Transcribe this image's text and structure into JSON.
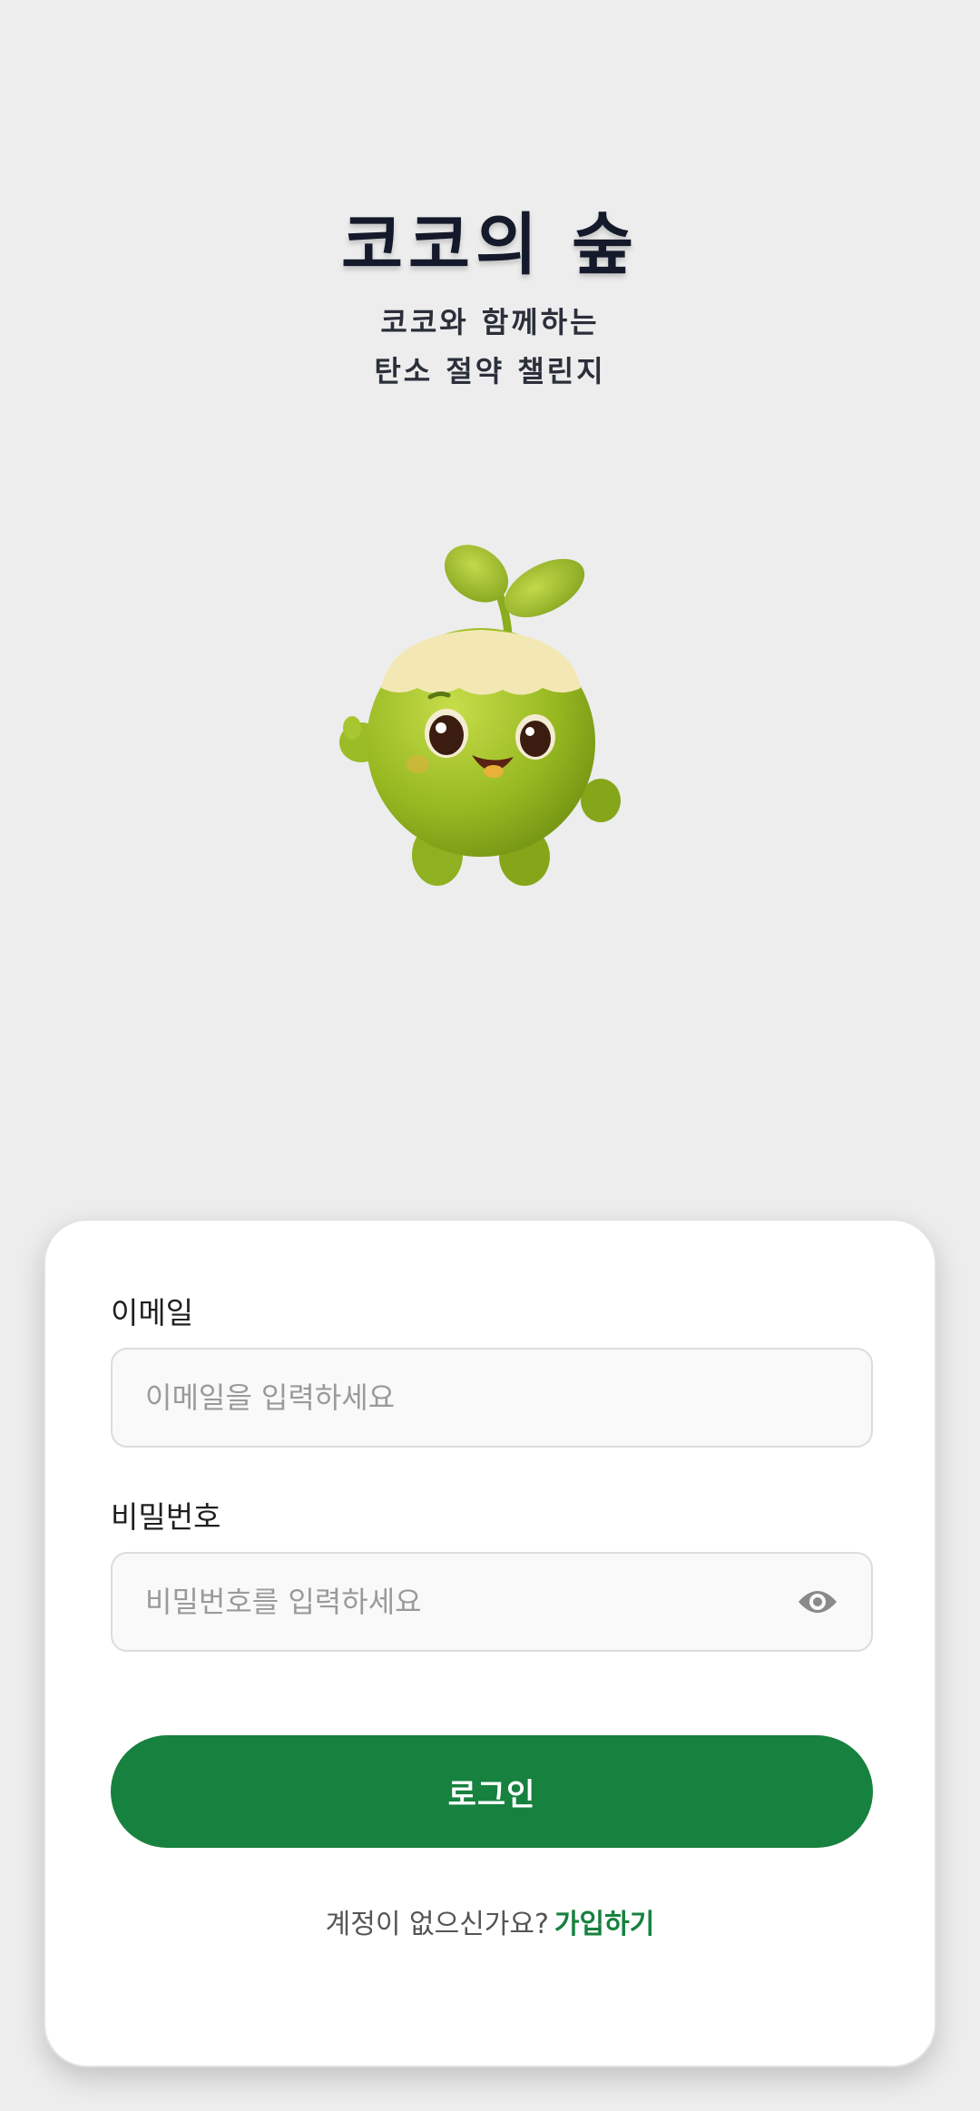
{
  "header": {
    "title": "코코의 숲",
    "subtitle_line1": "코코와 함께하는",
    "subtitle_line2": "탄소 절약 챌린지"
  },
  "mascot": {
    "icon": "sprout-mascot-icon"
  },
  "form": {
    "email_label": "이메일",
    "email_placeholder": "이메일을 입력하세요",
    "password_label": "비밀번호",
    "password_placeholder": "비밀번호를 입력하세요",
    "password_visibility_icon": "eye-icon",
    "login_button": "로그인"
  },
  "signup": {
    "prompt": "계정이 없으신가요?",
    "link": "가입하기"
  },
  "colors": {
    "background": "#ededed",
    "accent": "#17813f",
    "title": "#141a2b"
  }
}
